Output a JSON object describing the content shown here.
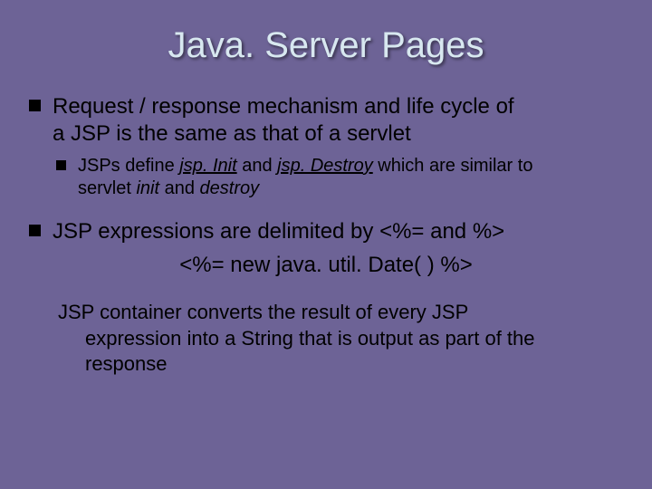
{
  "title": "Java. Server Pages",
  "b1_a": "Request / response mechanism and life cycle of",
  "b1_b": "a JSP is the same as that of a servlet",
  "s1_a": "JSPs define ",
  "s1_jspinit": "jsp. Init",
  "s1_b": " and ",
  "s1_jspdestroy": "jsp. Destroy",
  "s1_c": " which are similar to",
  "s1_d": "servlet ",
  "s1_init": "init",
  "s1_e": " and ",
  "s1_destroy": "destroy",
  "b2": "JSP expressions are delimited by <%= and %>",
  "expr": "<%= new java. util. Date( ) %>",
  "p1": "JSP container converts the result of every JSP",
  "p2": "expression into a String that is output as part of the",
  "p3": "response"
}
